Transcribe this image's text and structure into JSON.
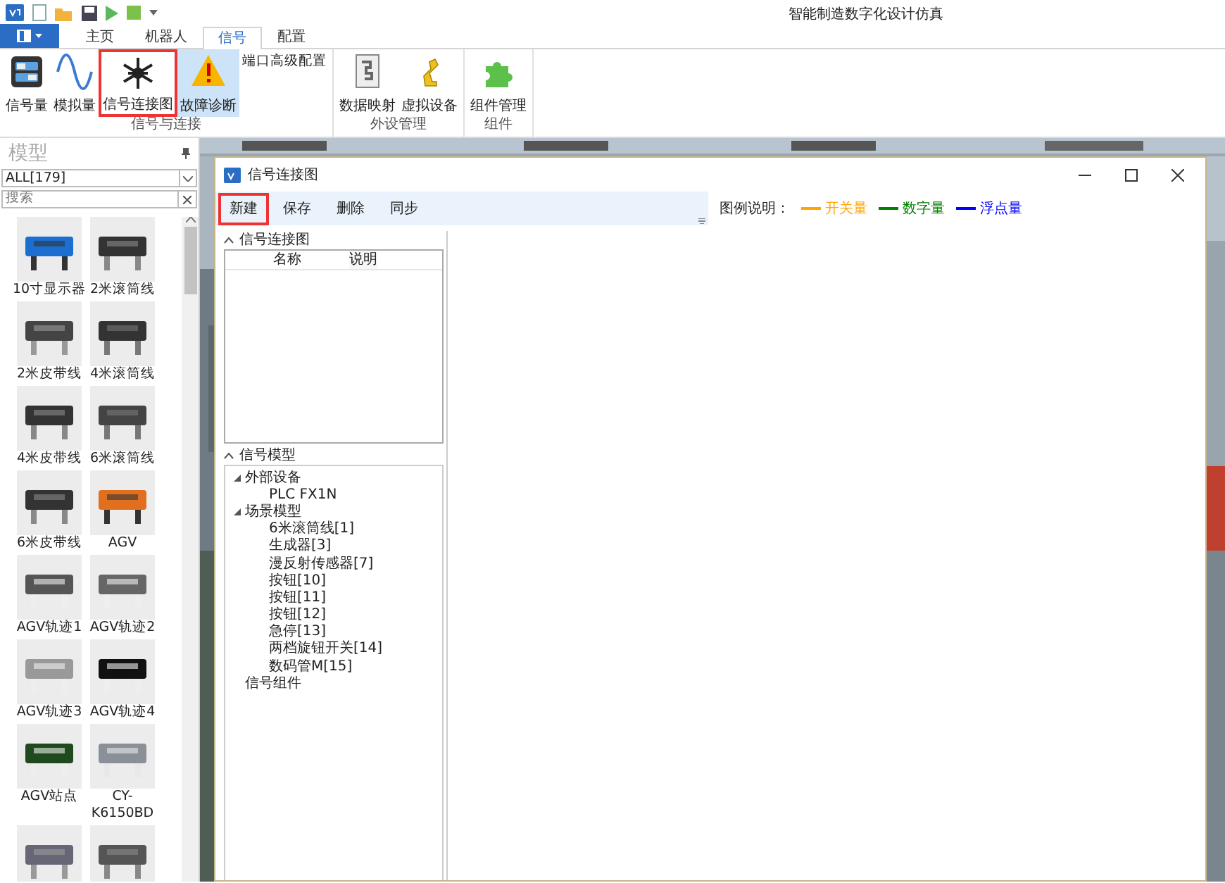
{
  "window": {
    "title": "智能制造数字化设计仿真"
  },
  "ribbon_tabs": [
    {
      "label": "主页",
      "selected": false
    },
    {
      "label": "机器人",
      "selected": false
    },
    {
      "label": "信号",
      "selected": true
    },
    {
      "label": "配置",
      "selected": false
    }
  ],
  "ribbon_groups": [
    {
      "label": "信号与连接",
      "buttons": [
        {
          "label": "信号量",
          "selected": false,
          "highlighted": false
        },
        {
          "label": "模拟量",
          "selected": false,
          "highlighted": false
        },
        {
          "label": "信号连接图",
          "selected": false,
          "highlighted": true
        },
        {
          "label": "故障诊断",
          "selected": true,
          "highlighted": false
        }
      ],
      "small_button": "端口高级配置"
    },
    {
      "label": "外设管理",
      "buttons": [
        {
          "label": "数据映射",
          "selected": false,
          "highlighted": false
        },
        {
          "label": "虚拟设备",
          "selected": false,
          "highlighted": false
        }
      ]
    },
    {
      "label": "组件",
      "buttons": [
        {
          "label": "组件管理",
          "selected": false,
          "highlighted": false
        }
      ]
    }
  ],
  "model_panel": {
    "title": "模型",
    "filter": "ALL[179]",
    "search": {
      "placeholder": "搜索"
    },
    "items": [
      {
        "name": "10寸显示器"
      },
      {
        "name": "2米滚筒线"
      },
      {
        "name": "2米皮带线"
      },
      {
        "name": "4米滚筒线"
      },
      {
        "name": "4米皮带线"
      },
      {
        "name": "6米滚筒线"
      },
      {
        "name": "6米皮带线"
      },
      {
        "name": "AGV"
      },
      {
        "name": "AGV轨迹1"
      },
      {
        "name": "AGV轨迹2"
      },
      {
        "name": "AGV轨迹3"
      },
      {
        "name": "AGV轨迹4"
      },
      {
        "name": "AGV站点"
      },
      {
        "name": "CY-K6150BD"
      },
      {
        "kind": "picture"
      },
      {
        "kind": "picture"
      }
    ]
  },
  "dialog": {
    "title": "信号连接图",
    "toolbar": [
      {
        "label": "新建",
        "highlighted": true
      },
      {
        "label": "保存",
        "highlighted": false
      },
      {
        "label": "删除",
        "highlighted": false
      },
      {
        "label": "同步",
        "highlighted": false
      }
    ],
    "legend": {
      "label": "图例说明：",
      "items": [
        {
          "label": "开关量",
          "color": "#ffa500"
        },
        {
          "label": "数字量",
          "color": "#008000"
        },
        {
          "label": "浮点量",
          "color": "#0000ff"
        }
      ]
    },
    "diagram_section": {
      "title": "信号连接图",
      "expanded": true,
      "columns": [
        "名称",
        "说明"
      ]
    },
    "model_section": {
      "title": "信号模型",
      "expanded": true,
      "tree": [
        {
          "label": "外部设备",
          "expanded": true,
          "children": [
            {
              "label": "PLC FX1N"
            }
          ]
        },
        {
          "label": "场景模型",
          "expanded": true,
          "children": [
            {
              "label": "6米滚筒线[1]"
            },
            {
              "label": "生成器[3]"
            },
            {
              "label": "漫反射传感器[7]"
            },
            {
              "label": "按钮[10]"
            },
            {
              "label": "按钮[11]"
            },
            {
              "label": "按钮[12]"
            },
            {
              "label": "急停[13]"
            },
            {
              "label": "两档旋钮开关[14]"
            },
            {
              "label": "数码管M[15]"
            }
          ]
        },
        {
          "label": "信号组件"
        }
      ]
    }
  }
}
